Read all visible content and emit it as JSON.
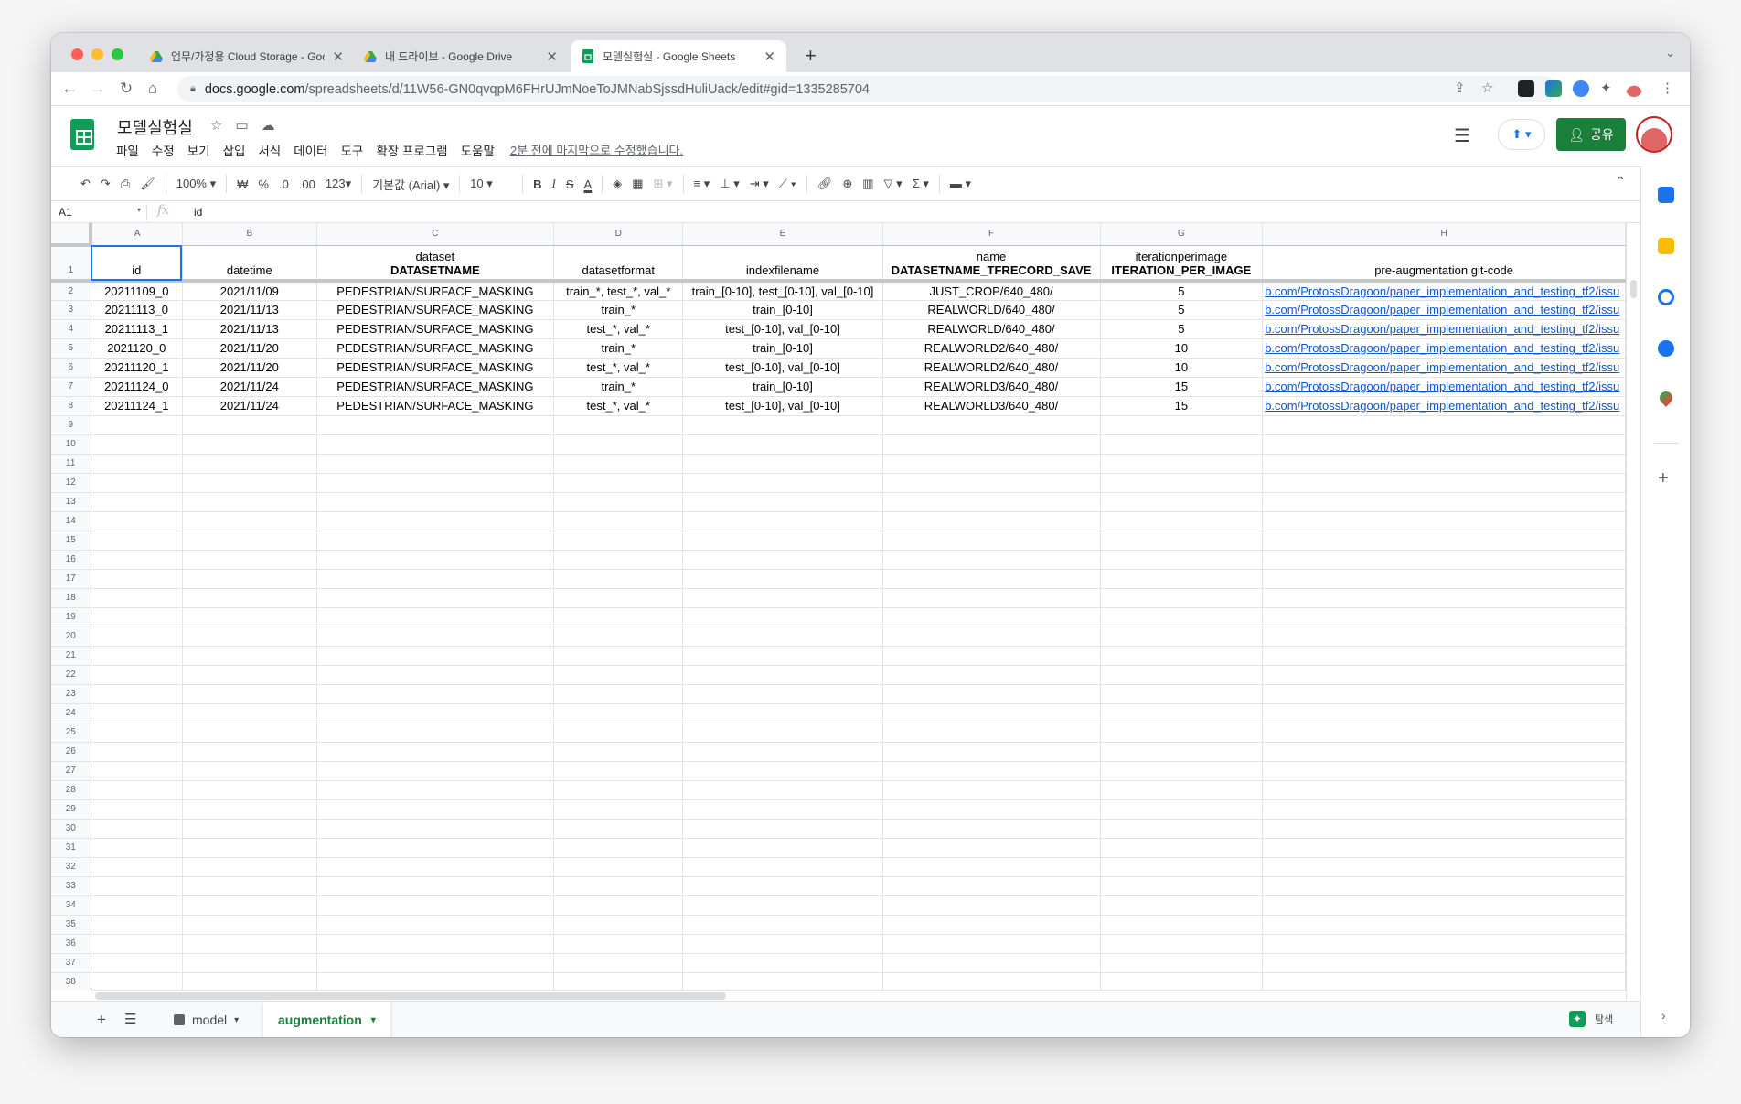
{
  "browser": {
    "tabs": [
      {
        "title": "업무/가정용 Cloud Storage - Goo",
        "icon": "google-drive-icon"
      },
      {
        "title": "내 드라이브 - Google Drive",
        "icon": "google-drive-icon"
      },
      {
        "title": "모델실험실 - Google Sheets",
        "icon": "google-sheets-icon"
      }
    ],
    "url_host": "docs.google.com",
    "url_path": "/spreadsheets/d/11W56-GN0qvqpM6FHrUJmNoeToJMNabSjssdHuliUack/edit#gid=1335285704"
  },
  "doc": {
    "title": "모델실험실",
    "menu": [
      "파일",
      "수정",
      "보기",
      "삽입",
      "서식",
      "데이터",
      "도구",
      "확장 프로그램",
      "도움말"
    ],
    "last_edit": "2분 전에 마지막으로 수정했습니다.",
    "share_label": "공유"
  },
  "toolbar": {
    "zoom": "100%",
    "currency": "₩",
    "percent": "%",
    "dec_decrease": ".0",
    "dec_increase": ".00",
    "format_more": "123",
    "font": "기본값 (Arial)",
    "font_size": "10"
  },
  "formula_bar": {
    "cell_ref": "A1",
    "content": "id"
  },
  "grid": {
    "columns": [
      "A",
      "B",
      "C",
      "D",
      "E",
      "F",
      "G",
      "H"
    ],
    "header_row": {
      "row_num": "1",
      "cells": [
        {
          "top": "",
          "bottom": "id"
        },
        {
          "top": "",
          "bottom": "datetime"
        },
        {
          "top": "dataset",
          "bottom": "DATASETNAME"
        },
        {
          "top": "",
          "bottom": "datasetformat"
        },
        {
          "top": "",
          "bottom": "indexfilename"
        },
        {
          "top": "name",
          "bottom": "DATASETNAME_TFRECORD_SAVE"
        },
        {
          "top": "iterationperimage",
          "bottom": "ITERATION_PER_IMAGE"
        },
        {
          "top": "",
          "bottom": "pre-augmentation git-code"
        }
      ]
    },
    "rows": [
      {
        "n": "2",
        "cells": [
          "20211109_0",
          "2021/11/09",
          "PEDESTRIAN/SURFACE_MASKING",
          "train_*, test_*, val_*",
          "train_[0-10], test_[0-10], val_[0-10]",
          "JUST_CROP/640_480/",
          "5",
          "b.com/ProtossDragoon/paper_implementation_and_testing_tf2/issu"
        ]
      },
      {
        "n": "3",
        "cells": [
          "20211113_0",
          "2021/11/13",
          "PEDESTRIAN/SURFACE_MASKING",
          "train_*",
          "train_[0-10]",
          "REALWORLD/640_480/",
          "5",
          "b.com/ProtossDragoon/paper_implementation_and_testing_tf2/issu"
        ]
      },
      {
        "n": "4",
        "cells": [
          "20211113_1",
          "2021/11/13",
          "PEDESTRIAN/SURFACE_MASKING",
          "test_*, val_*",
          "test_[0-10], val_[0-10]",
          "REALWORLD/640_480/",
          "5",
          "b.com/ProtossDragoon/paper_implementation_and_testing_tf2/issu"
        ]
      },
      {
        "n": "5",
        "cells": [
          "2021120_0",
          "2021/11/20",
          "PEDESTRIAN/SURFACE_MASKING",
          "train_*",
          "train_[0-10]",
          "REALWORLD2/640_480/",
          "10",
          "b.com/ProtossDragoon/paper_implementation_and_testing_tf2/issu"
        ]
      },
      {
        "n": "6",
        "cells": [
          "20211120_1",
          "2021/11/20",
          "PEDESTRIAN/SURFACE_MASKING",
          "test_*, val_*",
          "test_[0-10], val_[0-10]",
          "REALWORLD2/640_480/",
          "10",
          "b.com/ProtossDragoon/paper_implementation_and_testing_tf2/issu"
        ]
      },
      {
        "n": "7",
        "cells": [
          "20211124_0",
          "2021/11/24",
          "PEDESTRIAN/SURFACE_MASKING",
          "train_*",
          "train_[0-10]",
          "REALWORLD3/640_480/",
          "15",
          "b.com/ProtossDragoon/paper_implementation_and_testing_tf2/issu"
        ]
      },
      {
        "n": "8",
        "cells": [
          "20211124_1",
          "2021/11/24",
          "PEDESTRIAN/SURFACE_MASKING",
          "test_*, val_*",
          "test_[0-10], val_[0-10]",
          "REALWORLD3/640_480/",
          "15",
          "b.com/ProtossDragoon/paper_implementation_and_testing_tf2/issu"
        ]
      }
    ],
    "empty_row_start": 9,
    "empty_row_end": 38
  },
  "sheets": {
    "tabs": [
      {
        "label": "model",
        "active": false
      },
      {
        "label": "augmentation",
        "active": true
      }
    ],
    "explore_label": "탐색"
  },
  "colors": {
    "accent_green": "#188038",
    "link_blue": "#1155cc",
    "select_blue": "#1a73e8"
  }
}
